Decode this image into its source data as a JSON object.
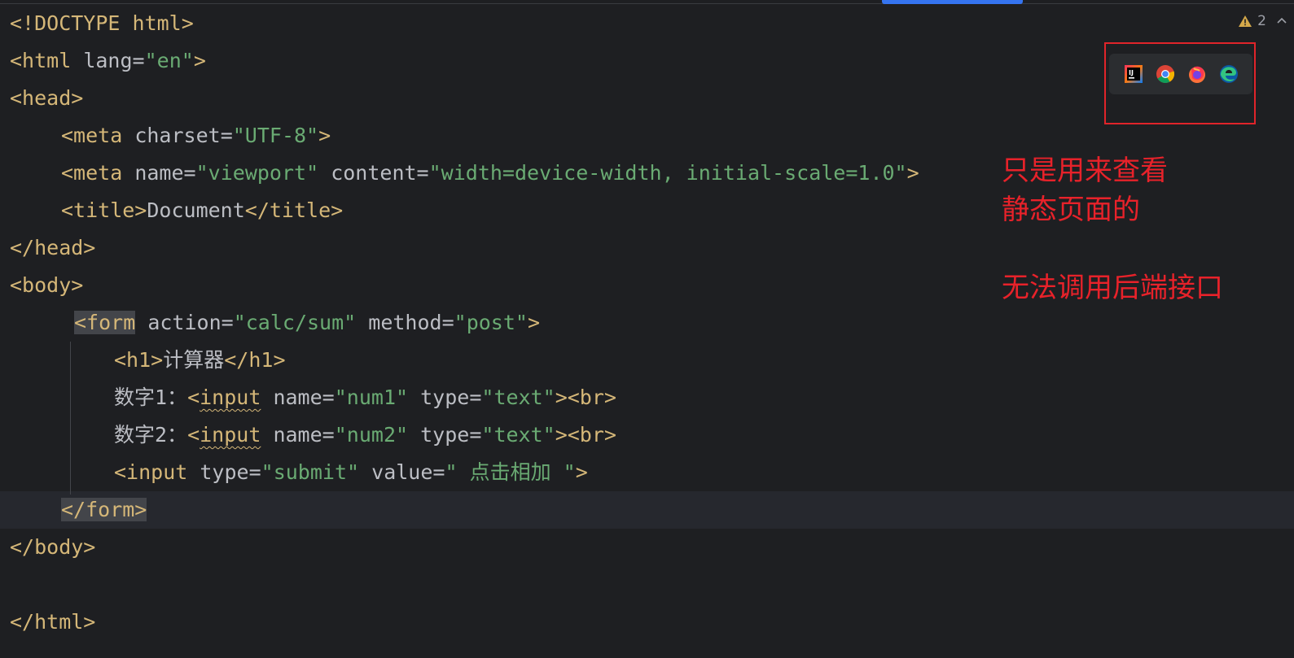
{
  "editor": {
    "lines": {
      "l1": {
        "doctype": "<!DOCTYPE html>"
      },
      "l2": {
        "open": "<html",
        "attr1": "lang",
        "eq1": "=",
        "val1": "\"en\"",
        "close": ">"
      },
      "l3": {
        "tag": "<head>"
      },
      "l4": {
        "open": "<meta",
        "attr1": "charset",
        "eq1": "=",
        "val1": "\"UTF-8\"",
        "close": ">"
      },
      "l5": {
        "open": "<meta",
        "attr1": "name",
        "eq1": "=",
        "val1": "\"viewport\"",
        "attr2": "content",
        "eq2": "=",
        "val2": "\"width=device-width, initial-scale=1.0\"",
        "close": ">"
      },
      "l6": {
        "open": "<title>",
        "text": "Document",
        "close": "</title>"
      },
      "l7": {
        "tag": "</head>"
      },
      "l8": {
        "tag": "<body>"
      },
      "l9": {
        "open": "<form",
        "attr1": "action",
        "eq1": "=",
        "val1": "\"calc/sum\"",
        "attr2": "method",
        "eq2": "=",
        "val2": "\"post\"",
        "close": ">"
      },
      "l10": {
        "open": "<h1>",
        "text": "计算器",
        "close": "</h1>"
      },
      "l11": {
        "label": "数字1：",
        "open": "<",
        "tagname": "input",
        "attr1": "name",
        "eq1": "=",
        "val1": "\"num1\"",
        "attr2": "type",
        "eq2": "=",
        "val2": "\"text\"",
        "close": "><br>"
      },
      "l12": {
        "label": "数字2：",
        "open": "<",
        "tagname": "input",
        "attr1": "name",
        "eq1": "=",
        "val1": "\"num2\"",
        "attr2": "type",
        "eq2": "=",
        "val2": "\"text\"",
        "close": "><br>"
      },
      "l13": {
        "open": "<input",
        "attr1": "type",
        "eq1": "=",
        "val1": "\"submit\"",
        "attr2": "value",
        "eq2": "=",
        "val2": "\" 点击相加 \"",
        "close": ">"
      },
      "l14": {
        "tag": "</form>"
      },
      "l15": {
        "tag": "</body>"
      },
      "l17": {
        "tag": "</html>"
      }
    }
  },
  "inspections": {
    "warning_count": "2"
  },
  "browser_popup": {
    "icons": [
      "intellij-icon",
      "chrome-icon",
      "firefox-icon",
      "edge-icon"
    ]
  },
  "annotations": {
    "note1_line1": "只是用来查看",
    "note1_line2": "静态页面的",
    "note2": "无法调用后端接口"
  },
  "colors": {
    "background": "#1e1f22",
    "tag": "#d5b778",
    "string": "#6aab73",
    "text": "#bcbec4",
    "annotation_red": "#e8222a",
    "scroll_accent": "#3574f0"
  }
}
